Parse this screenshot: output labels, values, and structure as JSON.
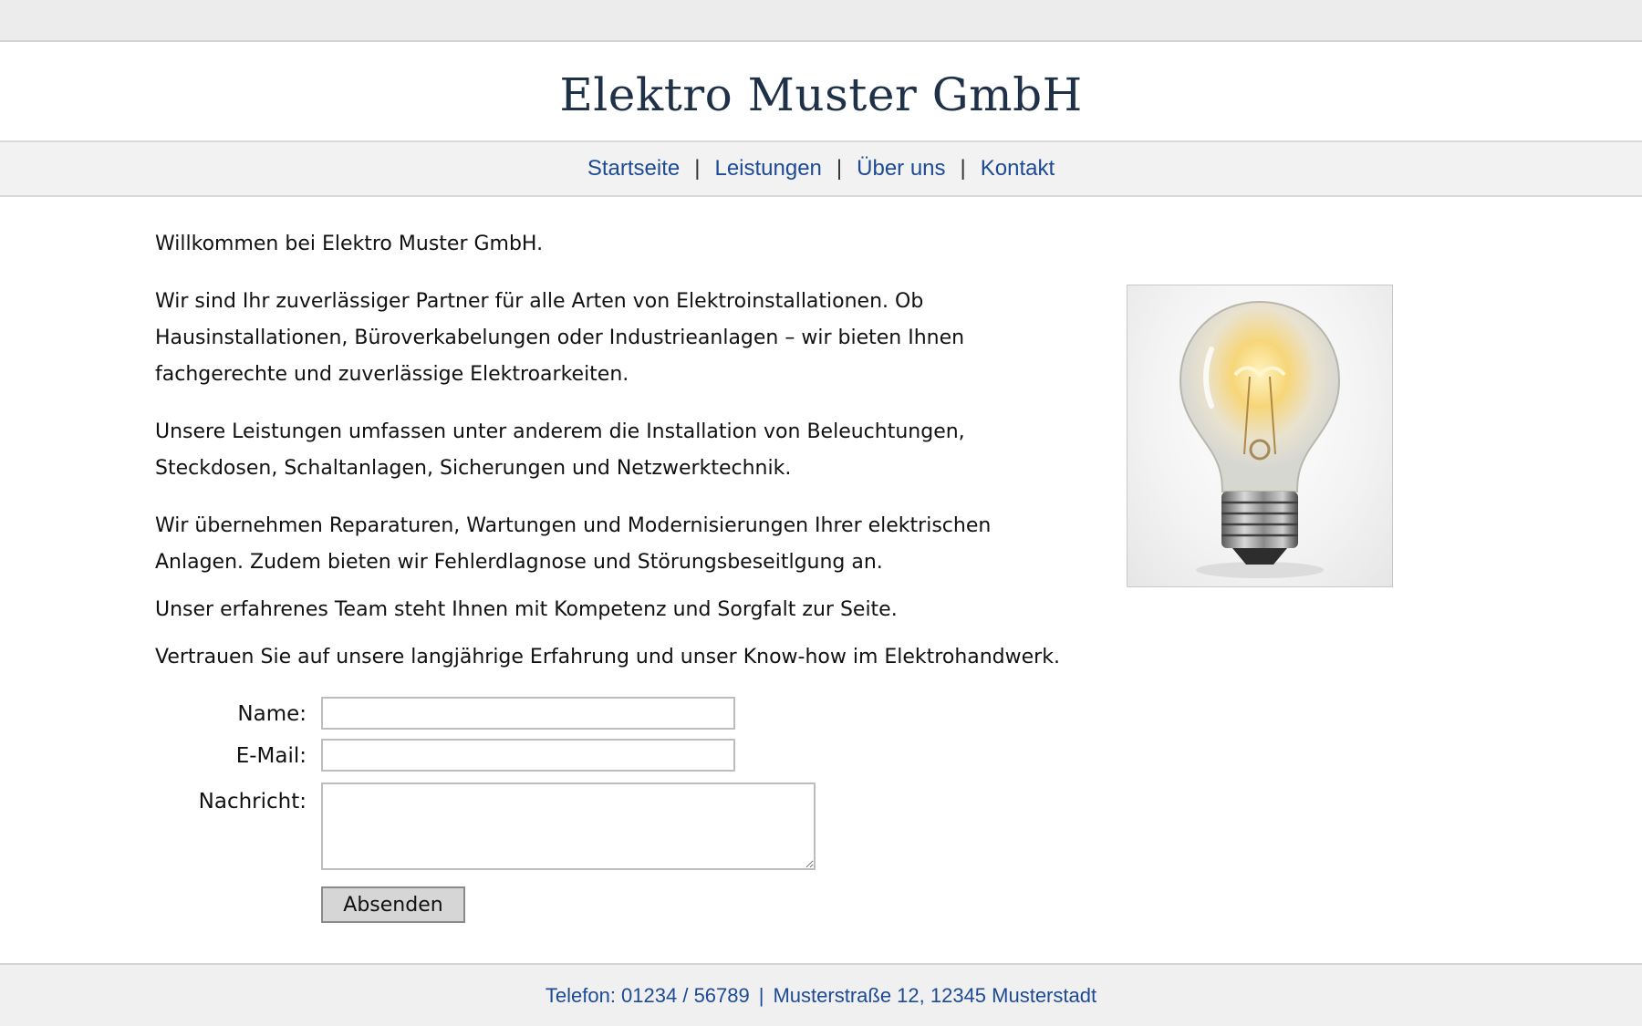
{
  "header": {
    "title": "Elektro Muster GmbH"
  },
  "nav": {
    "items": [
      {
        "label": "Startseite"
      },
      {
        "label": "Leistungen"
      },
      {
        "label": "Über uns"
      },
      {
        "label": "Kontakt"
      }
    ],
    "separator": "|"
  },
  "content": {
    "paragraphs": [
      "Willkommen bei Elektro Muster GmbH.",
      "Wir sind Ihr zuverlässiger Partner für alle Arten von Elektroinstallationen. Ob Hausinstallationen, Büroverkabelungen oder Industrieanlagen – wir bieten Ihnen fachgerechte und zuverlässige Elektroarkeiten.",
      "Unsere Leistungen umfassen unter anderem die Installation von Beleuchtungen, Steckdosen, Schaltanlagen, Sicherungen und Netzwerktechnik.",
      "Wir übernehmen Reparaturen, Wartungen und Modernisierungen Ihrer elektrischen Anlagen. Zudem bieten wir Fehlerdlagnose und Störungsbeseitlgung an.",
      "Unser erfahrenes Team steht Ihnen mit Kompetenz und Sorgfalt zur Seite.",
      "Vertrauen Sie auf unsere langjährige Erfahrung und unser Know-how im Elektrohandwerk."
    ]
  },
  "form": {
    "name_label": "Name:",
    "name_value": "",
    "email_label": "E-Mail:",
    "email_value": "",
    "message_label": "Nachricht:",
    "message_value": "",
    "submit_label": "Absenden"
  },
  "footer": {
    "phone": "Telefon: 01234 / 56789",
    "separator": "|",
    "address": "Musterstraße 12, 12345 Musterstadt"
  },
  "colors": {
    "title": "#1f3148",
    "link": "#1c4a96",
    "header_bg": "#ffffff",
    "nav_bg": "#f2f2f2",
    "footer_bg": "#f0f0f0"
  },
  "icons": {
    "hero_image": "light-bulb-image"
  }
}
